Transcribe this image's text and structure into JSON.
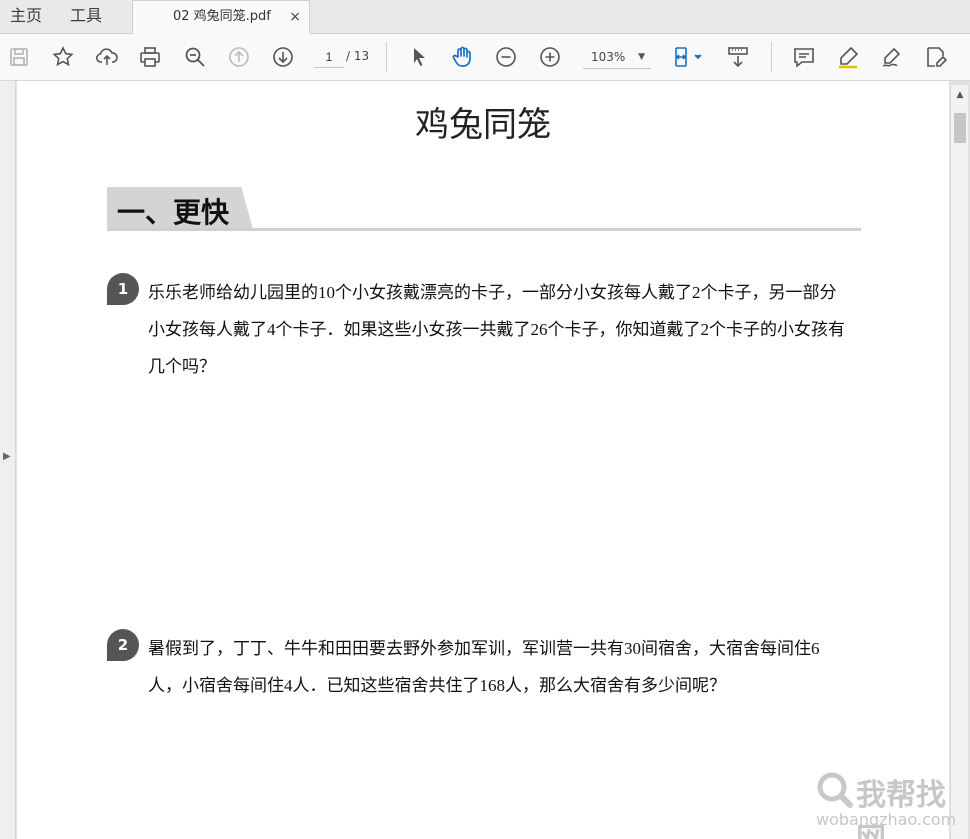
{
  "tabs": {
    "home": "主页",
    "tools": "工具",
    "document": "02 鸡兔同笼.pdf",
    "close_glyph": "×"
  },
  "toolbar": {
    "icons": [
      "save-icon",
      "bookmark-star-icon",
      "upload-cloud-icon",
      "print-icon",
      "zoom-out-magnifier-icon",
      "previous-page-icon",
      "next-page-icon",
      "select-arrow-icon",
      "hand-tool-icon",
      "zoom-minus-icon",
      "zoom-plus-icon",
      "fit-page-icon",
      "scroll-mode-icon",
      "comment-icon",
      "highlight-icon",
      "sign-icon",
      "edit-icon"
    ],
    "page_current": "1",
    "page_total": "/ 13",
    "zoom": "103%"
  },
  "document": {
    "title": "鸡兔同笼",
    "section": "一、更快",
    "questions": [
      {
        "number": "1",
        "text": "乐乐老师给幼儿园里的10个小女孩戴漂亮的卡子，一部分小女孩每人戴了2个卡子，另一部分小女孩每人戴了4个卡子．如果这些小女孩一共戴了26个卡子，你知道戴了2个卡子的小女孩有几个吗？"
      },
      {
        "number": "2",
        "text": "暑假到了，丁丁、牛牛和田田要去野外参加军训，军训营一共有30间宿舍，大宿舍每间住6人，小宿舍每间住4人．已知这些宿舍共住了168人，那么大宿舍有多少间呢？"
      }
    ]
  },
  "watermark": {
    "cn": "我帮找网",
    "en": "wobangzhao.com"
  },
  "colors": {
    "accent_blue": "#1a6fc4",
    "badge_gray": "#555555",
    "banner_gray": "#d4d4d4"
  }
}
